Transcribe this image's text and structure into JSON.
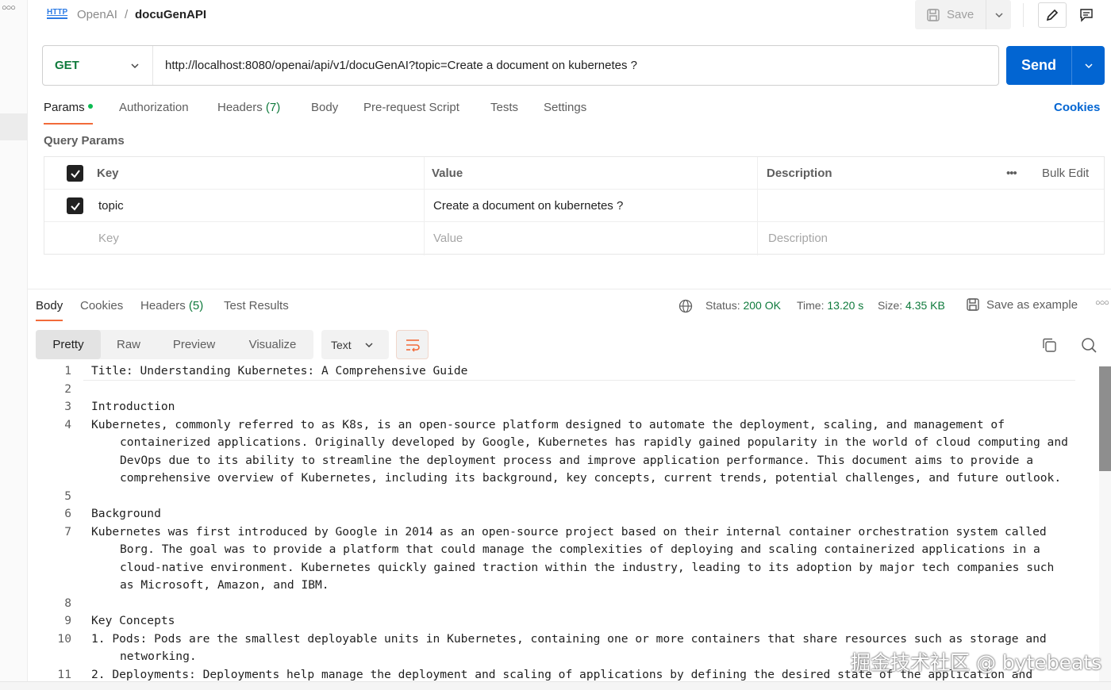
{
  "breadcrumb": {
    "parent": "OpenAI",
    "separator": "/",
    "current": "docuGenAPI",
    "icon": "http-icon"
  },
  "header": {
    "save_label": "Save"
  },
  "request": {
    "method": "GET",
    "url": "http://localhost:8080/openai/api/v1/docuGenAI?topic=Create a document on kubernetes ?",
    "send_label": "Send"
  },
  "req_tabs": {
    "params": "Params",
    "authorization": "Authorization",
    "headers": "Headers",
    "headers_count": "(7)",
    "body": "Body",
    "prerequest": "Pre-request Script",
    "tests": "Tests",
    "settings": "Settings",
    "cookies": "Cookies"
  },
  "query_params": {
    "title": "Query Params",
    "headers": {
      "key": "Key",
      "value": "Value",
      "description": "Description",
      "bulk_edit": "Bulk Edit"
    },
    "rows": [
      {
        "checked": true,
        "key": "topic",
        "value": "Create a document on kubernetes ?",
        "description": ""
      }
    ],
    "placeholders": {
      "key": "Key",
      "value": "Value",
      "description": "Description"
    }
  },
  "response": {
    "tabs": {
      "body": "Body",
      "cookies": "Cookies",
      "headers": "Headers",
      "headers_count": "(5)",
      "test_results": "Test Results"
    },
    "status_label": "Status:",
    "status_value": "200 OK",
    "time_label": "Time:",
    "time_value": "13.20 s",
    "size_label": "Size:",
    "size_value": "4.35 KB",
    "save_example": "Save as example",
    "formats": {
      "pretty": "Pretty",
      "raw": "Raw",
      "preview": "Preview",
      "visualize": "Visualize"
    },
    "language": "Text"
  },
  "body_lines": {
    "l1": {
      "num": "1",
      "text": "Title: Understanding Kubernetes: A Comprehensive Guide"
    },
    "l2": {
      "num": "2",
      "text": ""
    },
    "l3": {
      "num": "3",
      "text": "Introduction"
    },
    "l4": {
      "num": "4",
      "text": "Kubernetes, commonly referred to as K8s, is an open-source platform designed to automate the deployment, scaling, and management of",
      "c1": "containerized applications. Originally developed by Google, Kubernetes has rapidly gained popularity in the world of cloud computing and",
      "c2": "DevOps due to its ability to streamline the deployment process and improve application performance. This document aims to provide a",
      "c3": "comprehensive overview of Kubernetes, including its background, key concepts, current trends, potential challenges, and future outlook."
    },
    "l5": {
      "num": "5",
      "text": ""
    },
    "l6": {
      "num": "6",
      "text": "Background"
    },
    "l7": {
      "num": "7",
      "text": "Kubernetes was first introduced by Google in 2014 as an open-source project based on their internal container orchestration system called",
      "c1": "Borg. The goal was to provide a platform that could manage the complexities of deploying and scaling containerized applications in a",
      "c2": "cloud-native environment. Kubernetes quickly gained traction within the industry, leading to its adoption by major tech companies such",
      "c3": "as Microsoft, Amazon, and IBM."
    },
    "l8": {
      "num": "8",
      "text": ""
    },
    "l9": {
      "num": "9",
      "text": "Key Concepts"
    },
    "l10": {
      "num": "10",
      "text": "1. Pods: Pods are the smallest deployable units in Kubernetes, containing one or more containers that share resources such as storage and",
      "c1": "networking."
    },
    "l11": {
      "num": "11",
      "text": "2. Deployments: Deployments help manage the deployment and scaling of applications by defining the desired state of the application and"
    }
  },
  "watermark": "掘金技术社区 @ bytebeats",
  "colors": {
    "accent": "#f26b3a",
    "send": "#0265d2",
    "method": "#0f7a3c",
    "status_ok": "#0f7a3c",
    "dot": "#0cbb52"
  }
}
